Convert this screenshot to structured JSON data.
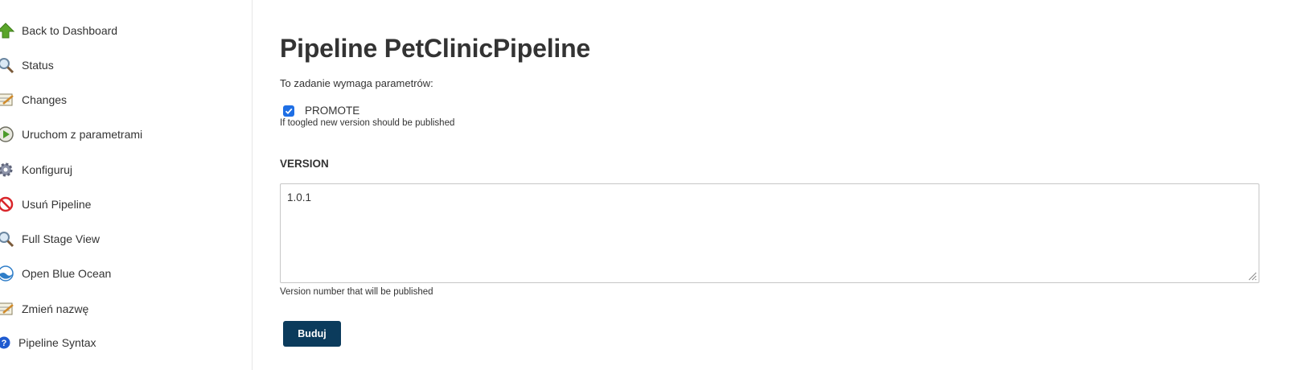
{
  "sidebar": {
    "items": [
      {
        "label": "Back to Dashboard",
        "icon": "up-arrow-icon"
      },
      {
        "label": "Status",
        "icon": "magnifier-icon"
      },
      {
        "label": "Changes",
        "icon": "notepad-icon"
      },
      {
        "label": "Uruchom z parametrami",
        "icon": "clock-play-icon"
      },
      {
        "label": "Konfiguruj",
        "icon": "gear-icon"
      },
      {
        "label": "Usuń Pipeline",
        "icon": "no-entry-icon"
      },
      {
        "label": "Full Stage View",
        "icon": "magnifier-icon"
      },
      {
        "label": "Open Blue Ocean",
        "icon": "blue-ocean-icon"
      },
      {
        "label": "Zmień nazwę",
        "icon": "notepad-icon"
      },
      {
        "label": "Pipeline Syntax",
        "icon": "help-icon"
      }
    ]
  },
  "main": {
    "title": "Pipeline PetClinicPipeline",
    "intro": "To zadanie wymaga parametrów:",
    "promote": {
      "label": "PROMOTE",
      "checked": true,
      "help": "If toogled new version should be published"
    },
    "version": {
      "label": "VERSION",
      "value": "1.0.1",
      "help": "Version number that will be published"
    },
    "build_button": "Buduj"
  },
  "colors": {
    "accent_button": "#0b3b5c",
    "checkbox": "#1f6fe5"
  }
}
